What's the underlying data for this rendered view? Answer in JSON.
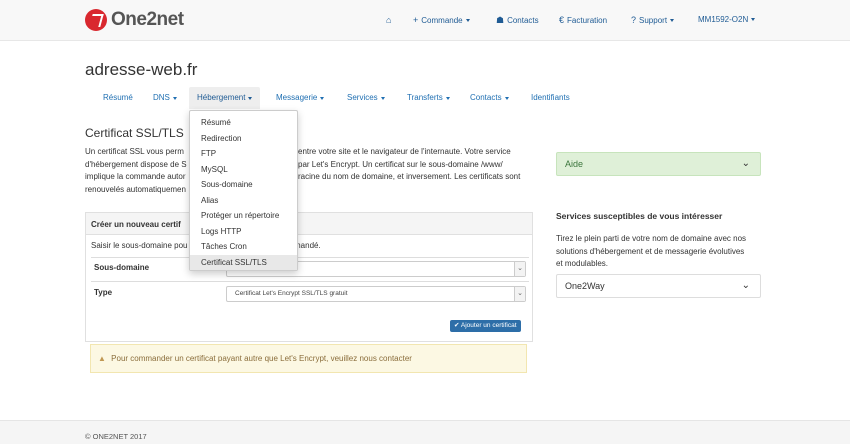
{
  "brand": {
    "name": "One2net",
    "accent": "#d9282f"
  },
  "topnav": {
    "home_icon": "home-icon",
    "commande": "Commande",
    "contacts": "Contacts",
    "facturation": "Facturation",
    "support": "Support",
    "account": "MM1592-O2N"
  },
  "page": {
    "title": "adresse-web.fr"
  },
  "tabs": [
    {
      "label": "Résumé"
    },
    {
      "label": "DNS"
    },
    {
      "label": "Hébergement"
    },
    {
      "label": "Messagerie"
    },
    {
      "label": "Services"
    },
    {
      "label": "Transferts"
    },
    {
      "label": "Contacts"
    },
    {
      "label": "Identifiants"
    }
  ],
  "dropdown": {
    "items": [
      "Résumé",
      "Redirection",
      "FTP",
      "MySQL",
      "Sous-domaine",
      "Alias",
      "Protéger un répertoire",
      "Logs HTTP",
      "Tâches Cron",
      "Certificat SSL/TLS"
    ]
  },
  "main": {
    "section_title": "Certificat SSL/TLS",
    "intro_lines": [
      "Un certificat SSL vous perm",
      "d'hébergement dispose de S",
      "implique la commande autor",
      "renouvelés automatiquemen"
    ],
    "intro_right_lines": [
      "entre votre site et le navigateur de l'internaute. Votre service",
      "par Let's Encrypt. Un certificat sur le sous-domaine /www/",
      "racine du nom de domaine, et inversement. Les certificats sont",
      ""
    ],
    "panel_title": "Créer un nouveau certif",
    "panel_desc_left": "Saisir le sous-domaine pou",
    "panel_desc_right": "mandé.",
    "subdomain_label": "Sous-domaine",
    "type_label": "Type",
    "type_value": "Certificat Let's Encrypt SSL/TLS gratuit",
    "add_button": "Ajouter un certificat",
    "alert": "Pour commander un certificat payant autre que Let's Encrypt, veuillez nous contacter"
  },
  "sidebar": {
    "aide": "Aide",
    "services_title": "Services susceptibles de vous intéresser",
    "services_text_lines": [
      "Tirez le plein parti de votre nom de domaine avec nos",
      "solutions d'hébergement et de messagerie évolutives",
      "et modulables."
    ],
    "one2way": "One2Way"
  },
  "footer": {
    "copyright": "© ONE2NET 2017"
  }
}
